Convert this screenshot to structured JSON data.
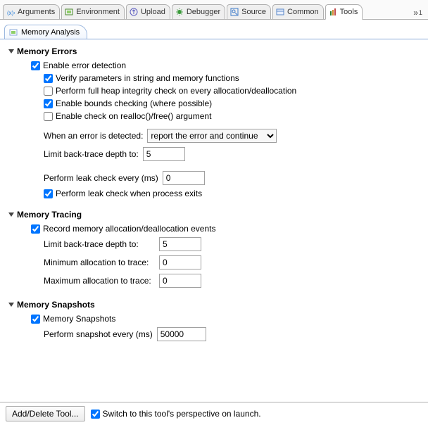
{
  "top_tabs": {
    "arguments": "Arguments",
    "environment": "Environment",
    "upload": "Upload",
    "debugger": "Debugger",
    "source": "Source",
    "common": "Common",
    "tools": "Tools",
    "overflow": "1"
  },
  "sub_tabs": {
    "memory_analysis": "Memory Analysis"
  },
  "sections": {
    "errors": {
      "title": "Memory Errors",
      "enable": "Enable error detection",
      "verify": "Verify parameters in string and memory functions",
      "full_heap": "Perform full heap integrity check on every allocation/deallocation",
      "bounds": "Enable bounds checking (where possible)",
      "realloc": "Enable check on realloc()/free() argument",
      "on_error_label": "When an error is detected:",
      "on_error_value": "report the error and continue",
      "backtrace_label": "Limit back-trace depth to:",
      "backtrace_value": "5",
      "leak_every_label": "Perform leak check every (ms)",
      "leak_every_value": "0",
      "leak_exit": "Perform leak check when process exits"
    },
    "tracing": {
      "title": "Memory Tracing",
      "record": "Record memory allocation/deallocation events",
      "backtrace_label": "Limit back-trace depth to:",
      "backtrace_value": "5",
      "min_label": "Minimum allocation to trace:",
      "min_value": "0",
      "max_label": "Maximum allocation to trace:",
      "max_value": "0"
    },
    "snapshots": {
      "title": "Memory Snapshots",
      "enable": "Memory Snapshots",
      "every_label": "Perform snapshot every (ms)",
      "every_value": "50000"
    }
  },
  "bottom": {
    "add_delete": "Add/Delete Tool...",
    "switch": "Switch to this tool's perspective on launch."
  }
}
